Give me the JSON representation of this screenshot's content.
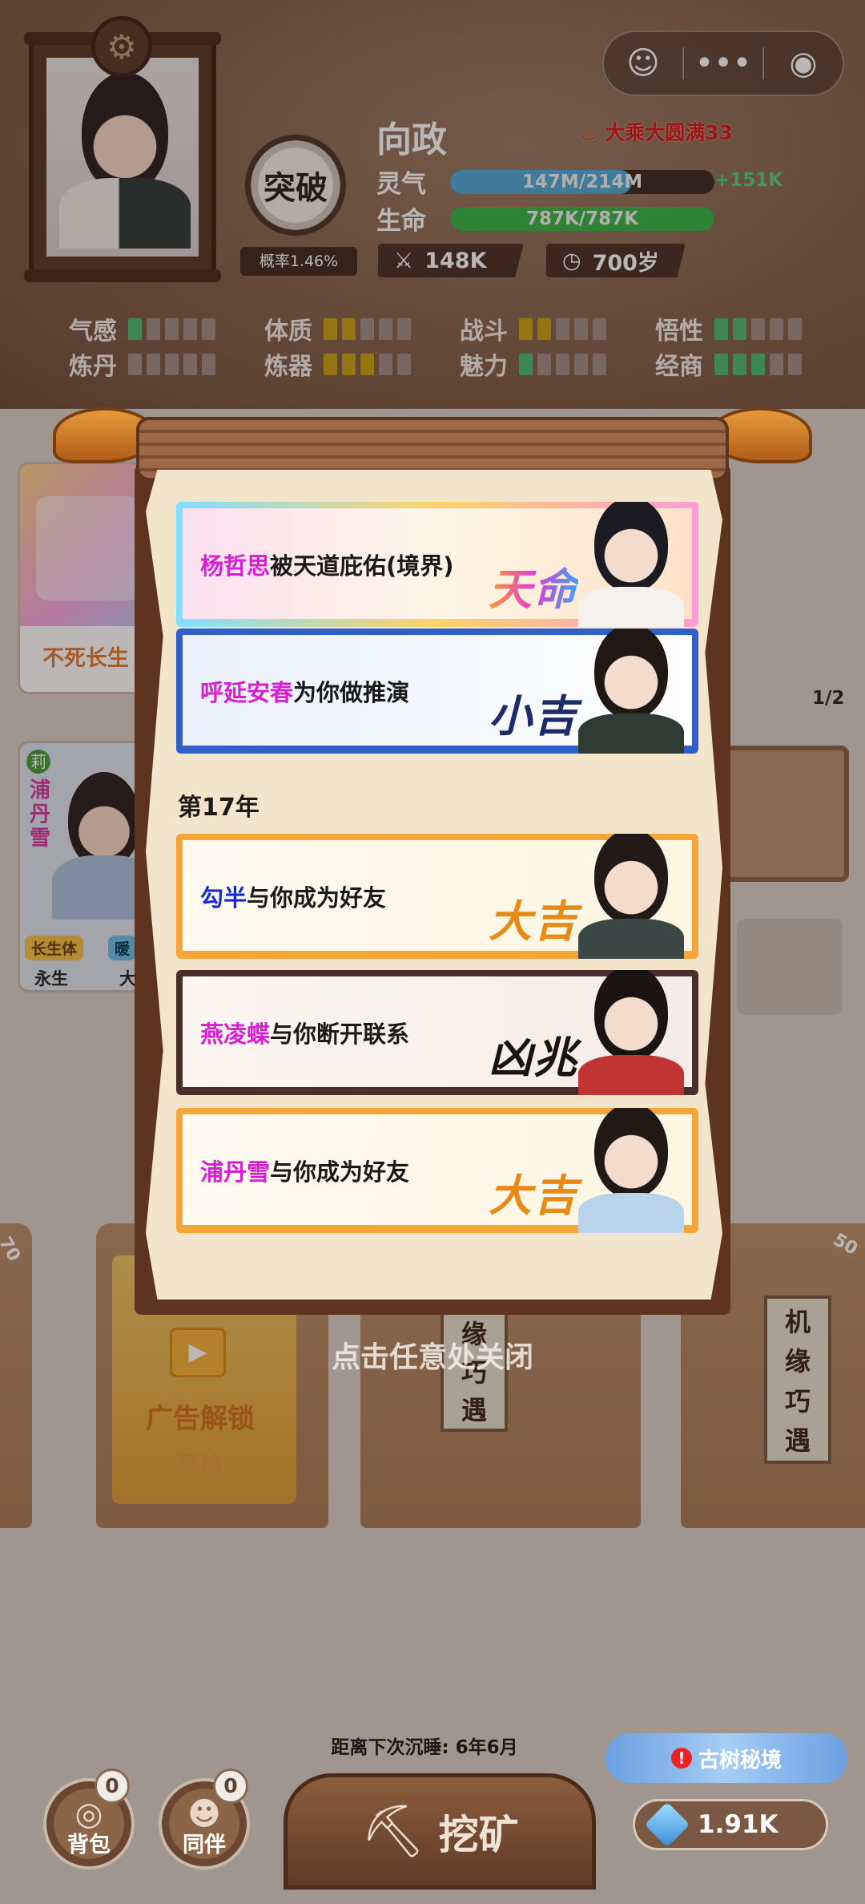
{
  "capsule": {
    "ghost_icon": "ghost-icon",
    "more_icon": "more-dots-icon",
    "close_icon": "target-close-icon"
  },
  "player": {
    "name": "向政",
    "realm": "大乘大圆满33",
    "breakthrough_label": "突破",
    "breakthrough_rate": "概率1.46%",
    "qi_label": "灵气",
    "qi_value": "147M/214M",
    "qi_fraction": 0.687,
    "qi_gain": "+151K",
    "hp_label": "生命",
    "hp_value": "787K/787K",
    "hp_fraction": 1.0,
    "power": "148K",
    "age": "700岁"
  },
  "attributes": [
    {
      "name": "气感",
      "filled": 1,
      "total": 5,
      "color": "green"
    },
    {
      "name": "体质",
      "filled": 2,
      "total": 5,
      "color": "gold"
    },
    {
      "name": "战斗",
      "filled": 2,
      "total": 5,
      "color": "gold"
    },
    {
      "name": "悟性",
      "filled": 2,
      "total": 5,
      "color": "green"
    },
    {
      "name": "炼丹",
      "filled": 0,
      "total": 5,
      "color": "green"
    },
    {
      "name": "炼器",
      "filled": 3,
      "total": 5,
      "color": "gold"
    },
    {
      "name": "魅力",
      "filled": 1,
      "total": 5,
      "color": "green"
    },
    {
      "name": "经商",
      "filled": 3,
      "total": 5,
      "color": "green"
    }
  ],
  "background": {
    "card_top_text": "不死长生",
    "card_bottom_name": "浦丹雪",
    "card_bottom_tag": "莉",
    "card_bottom_trait": "长生体",
    "card_bottom_trait2": "暖",
    "card_bottom_status": "永生",
    "card_bottom_status2": "大",
    "page_indicator": "1/2",
    "ad_unlock": "广告解锁",
    "ad_sub": "灵植",
    "slip_text": [
      "机",
      "缘",
      "巧",
      "遇"
    ],
    "corner_left": "70",
    "corner_right": "50"
  },
  "events": {
    "year_heading": "第17年",
    "items": [
      {
        "name": "杨哲思",
        "name_color": "#d61fd0",
        "text": "被天道庇佑(境界)",
        "stamp": "天命",
        "tier": "tianming"
      },
      {
        "name": "呼延安春",
        "name_color": "#d61fd0",
        "text": "为你做推演",
        "stamp": "小吉",
        "tier": "xiaoji"
      },
      {
        "name": "勾半",
        "name_color": "#1b2ad6",
        "text": "与你成为好友",
        "stamp": "大吉",
        "tier": "daji"
      },
      {
        "name": "燕凌蝶",
        "name_color": "#d61fd0",
        "text": "与你断开联系",
        "stamp": "凶兆",
        "tier": "xiongzhao"
      },
      {
        "name": "浦丹雪",
        "name_color": "#d61fd0",
        "text": "与你成为好友",
        "stamp": "大吉",
        "tier": "daji"
      }
    ]
  },
  "close_hint": "点击任意处关闭",
  "bottom": {
    "sleep_countdown": "距离下次沉睡: 6年6月",
    "bag_label": "背包",
    "bag_count": "0",
    "companion_label": "同伴",
    "companion_count": "0",
    "mine_label": "挖矿",
    "ancient_tree": "古树秘境",
    "ancient_tree_alert": "!",
    "crystals": "1.91K"
  },
  "colors": {
    "qi_bar": "#4fa9d6",
    "hp_bar": "#38b44a",
    "accent_brown": "#7f5f49"
  }
}
